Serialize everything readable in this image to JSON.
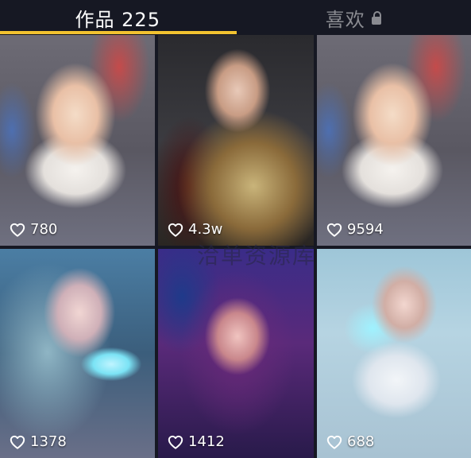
{
  "tabs": {
    "works_label": "作品 225",
    "likes_label": "喜欢",
    "lock_icon": "lock-icon"
  },
  "colors": {
    "background": "#161823",
    "indicator": "#f2c230",
    "active_text": "#ffffff",
    "inactive_text": "#8a8b91"
  },
  "videos": [
    {
      "likes": "780"
    },
    {
      "likes": "4.3w"
    },
    {
      "likes": "9594"
    },
    {
      "likes": "1378"
    },
    {
      "likes": "1412"
    },
    {
      "likes": "688"
    }
  ],
  "watermark": "洽单资源库"
}
